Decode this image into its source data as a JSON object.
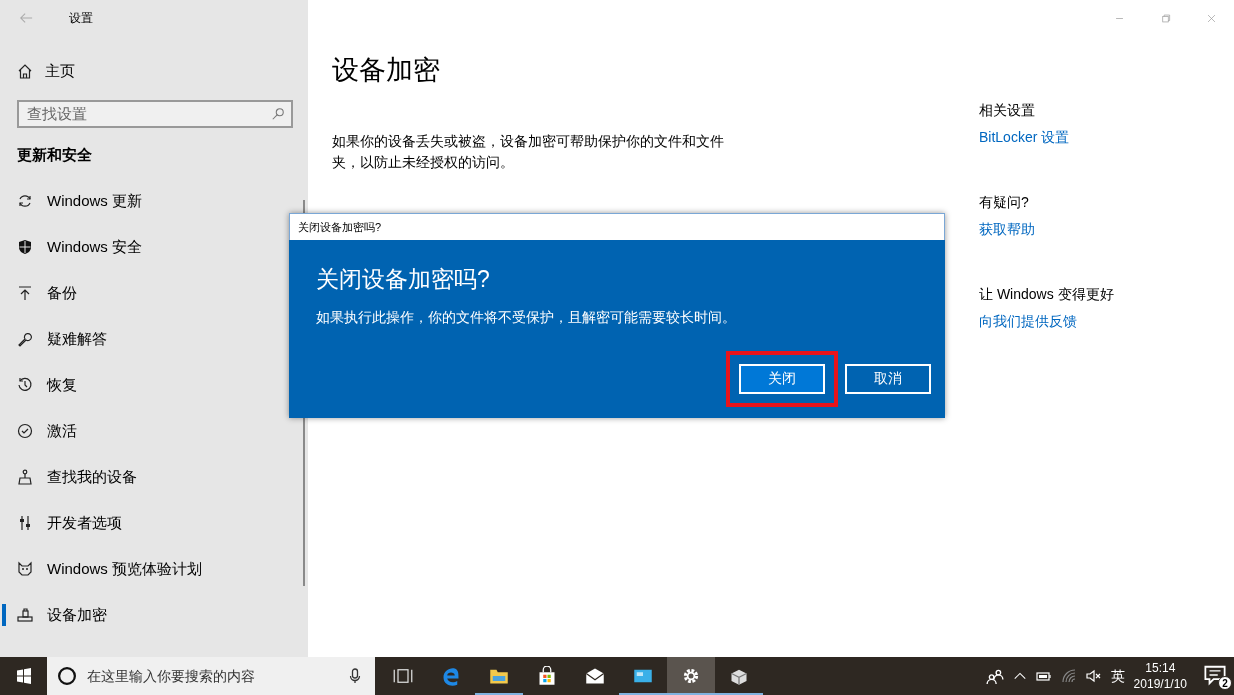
{
  "window": {
    "title": "设置"
  },
  "sidebar": {
    "home": "主页",
    "search": {
      "placeholder": "查找设置"
    },
    "section": "更新和安全",
    "items": [
      {
        "kind": "update",
        "label": "Windows 更新",
        "selected": false
      },
      {
        "kind": "shield",
        "label": "Windows 安全",
        "selected": false
      },
      {
        "kind": "backup",
        "label": "备份",
        "selected": false
      },
      {
        "kind": "troubleshoot",
        "label": "疑难解答",
        "selected": false
      },
      {
        "kind": "recovery",
        "label": "恢复",
        "selected": false
      },
      {
        "kind": "activation",
        "label": "激活",
        "selected": false
      },
      {
        "kind": "find-device",
        "label": "查找我的设备",
        "selected": false
      },
      {
        "kind": "developer",
        "label": "开发者选项",
        "selected": false
      },
      {
        "kind": "insider",
        "label": "Windows 预览体验计划",
        "selected": false
      },
      {
        "kind": "encryption",
        "label": "设备加密",
        "selected": true
      }
    ]
  },
  "main": {
    "title": "设备加密",
    "description": "如果你的设备丢失或被盗，设备加密可帮助保护你的文件和文件夹，以防止未经授权的访问。"
  },
  "related": [
    {
      "heading": "相关设置",
      "link": "BitLocker 设置"
    },
    {
      "heading": "有疑问?",
      "link": "获取帮助"
    },
    {
      "heading": "让 Windows 变得更好",
      "link": "向我们提供反馈"
    }
  ],
  "dialog": {
    "title": "关闭设备加密吗?",
    "heading": "关闭设备加密吗?",
    "message": "如果执行此操作，你的文件将不受保护，且解密可能需要较长时间。",
    "buttons": [
      {
        "label": "关闭",
        "primary": true,
        "highlighted": true
      },
      {
        "label": "取消",
        "primary": false,
        "highlighted": false
      }
    ]
  },
  "taskbar": {
    "search": {
      "placeholder": "在这里输入你要搜索的内容"
    },
    "apps": [
      {
        "kind": "taskview",
        "running": false,
        "selected": false
      },
      {
        "kind": "browser",
        "running": false,
        "selected": false
      },
      {
        "kind": "folder",
        "running": true,
        "selected": false
      },
      {
        "kind": "store",
        "running": false,
        "selected": false
      },
      {
        "kind": "mail",
        "running": false,
        "selected": false
      },
      {
        "kind": "app",
        "running": true,
        "selected": false
      },
      {
        "kind": "settings",
        "running": true,
        "selected": true
      },
      {
        "kind": "package",
        "running": true,
        "selected": false
      }
    ],
    "input_method": "英",
    "time": "15:14",
    "date": "2019/1/10",
    "notifications": "2"
  }
}
